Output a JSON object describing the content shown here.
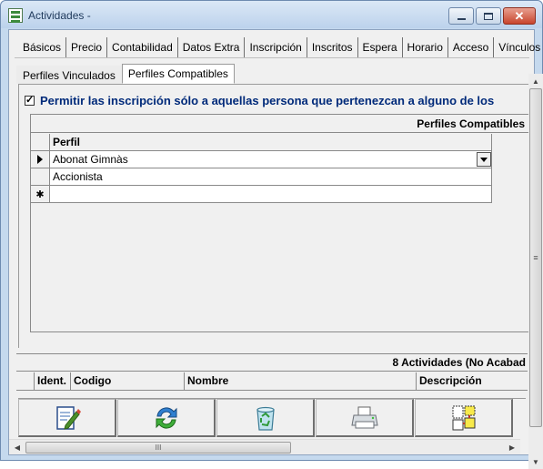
{
  "window": {
    "title": "Actividades -"
  },
  "main_tabs": [
    "Básicos",
    "Precio",
    "Contabilidad",
    "Datos Extra",
    "Inscripción",
    "Inscritos",
    "Espera",
    "Horario",
    "Acceso",
    "Vínculos"
  ],
  "sub_tabs": [
    "Perfiles Vinculados",
    "Perfiles Compatibles"
  ],
  "active_sub_tab": "Perfiles Compatibles",
  "checkbox": {
    "label": "Permitir las inscripción sólo a aquellas persona que pertenezcan a alguno de los",
    "checked": true
  },
  "profiles_grid": {
    "caption": "Perfiles Compatibles",
    "column": "Perfil",
    "rows": [
      "Abonat Gimnàs",
      "Accionista"
    ],
    "new_row_marker": "✱"
  },
  "activities": {
    "caption": "8 Actividades  (No Acabad",
    "columns": [
      "Ident.",
      "Codigo",
      "Nombre",
      "Descripción"
    ]
  },
  "toolbar": {
    "buttons": [
      "edit-icon",
      "refresh-icon",
      "recycle-bin-icon",
      "printer-icon",
      "compare-documents-icon"
    ]
  },
  "scrollbars": {
    "v_grip": "≡",
    "h_grip": "III"
  }
}
